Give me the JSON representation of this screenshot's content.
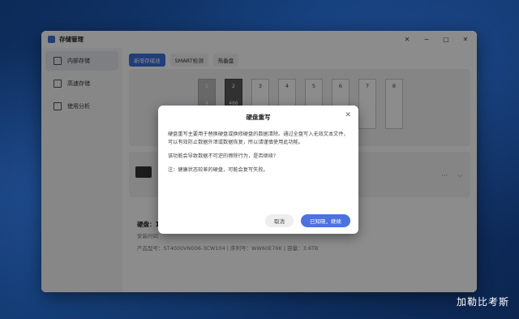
{
  "window": {
    "title": "存储管理",
    "controls": [
      "✕",
      "−",
      "□",
      "✕"
    ]
  },
  "sidebar": {
    "items": [
      {
        "label": "内部存储",
        "icon": "internal-storage-icon"
      },
      {
        "label": "高速存储",
        "icon": "fast-storage-icon"
      },
      {
        "label": "使用分析",
        "icon": "analysis-icon"
      }
    ]
  },
  "main": {
    "tabs": [
      {
        "label": "新增存储池"
      },
      {
        "label": "SMART检测"
      },
      {
        "label": "热备盘"
      }
    ],
    "slots": [
      {
        "num": "1",
        "cap": "4"
      },
      {
        "num": "2",
        "cap": "466"
      },
      {
        "num": "3",
        "cap": ""
      },
      {
        "num": "4",
        "cap": ""
      },
      {
        "num": "5",
        "cap": ""
      },
      {
        "num": "6",
        "cap": ""
      },
      {
        "num": "7",
        "cap": ""
      },
      {
        "num": "8",
        "cap": ""
      }
    ],
    "card_more": "···",
    "card_chevron": "⌵",
    "disk": {
      "heading": "硬盘：1",
      "status_prefix": "安装时间",
      "model_line": "产品型号：ST4000VN006-3CW104 | 序列号：WW60E76K | 容量：3.6TB"
    }
  },
  "dialog": {
    "title": "硬盘重写",
    "close": "✕",
    "para1": "硬盘重写主要用于替换硬盘或换修硬盘的数据清除。通过全盘写入无效文本文件，可以有效防止数据外泄或数据恢复，所以请谨慎使用此功能。",
    "para2": "该功能会导致数据不可逆的擦除行为，是否继续?",
    "para3": "注：健康状态较差的硬盘，可能会复写失败。",
    "cancel_label": "取消",
    "confirm_label": "已知晓，继续"
  },
  "watermark": "加勒比考斯"
}
